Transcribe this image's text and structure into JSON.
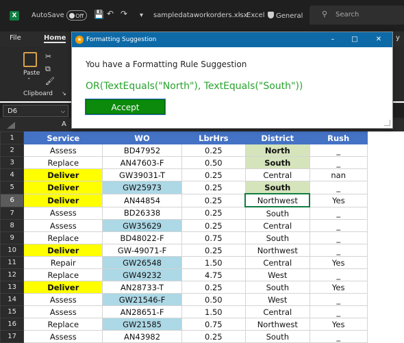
{
  "titlebar": {
    "autosave_label": "AutoSave",
    "autosave_state": "Off",
    "filename": "sampledataworkorders.xlsx",
    "app": "Excel",
    "sensitivity": "General",
    "search_placeholder": "Search"
  },
  "ribbon_tabs": {
    "file": "File",
    "home": "Home",
    "more": "y"
  },
  "ribbon": {
    "paste": "Paste",
    "clipboard": "Clipboard"
  },
  "namebox": "D6",
  "column_hint": "A",
  "dialog": {
    "title": "Formatting Suggestion",
    "message": "You have a Formatting Rule Suggestion",
    "formula": "OR(TextEquals(\"North\"), TextEquals(\"South\"))",
    "accept": "Accept"
  },
  "table": {
    "headers": [
      "Service",
      "WO",
      "LbrHrs",
      "District",
      "Rush"
    ],
    "rows": [
      {
        "n": "2",
        "cells": [
          "Assess",
          "BD47952",
          "0.25",
          "North",
          "_"
        ],
        "styles": [
          "",
          "",
          "",
          "grn",
          ""
        ]
      },
      {
        "n": "3",
        "cells": [
          "Replace",
          "AN47603-F",
          "0.50",
          "South",
          "_"
        ],
        "styles": [
          "",
          "",
          "",
          "grn",
          ""
        ]
      },
      {
        "n": "4",
        "cells": [
          "Deliver",
          "GW39031-T",
          "0.25",
          "Central",
          "nan"
        ],
        "styles": [
          "yel",
          "",
          "",
          "",
          ""
        ]
      },
      {
        "n": "5",
        "cells": [
          "Deliver",
          "GW25973",
          "0.25",
          "South",
          "_"
        ],
        "styles": [
          "yel",
          "blu",
          "",
          "grn",
          ""
        ]
      },
      {
        "n": "6",
        "cells": [
          "Deliver",
          "AN44854",
          "0.25",
          "Northwest",
          "Yes"
        ],
        "styles": [
          "yel",
          "",
          "",
          "act",
          ""
        ]
      },
      {
        "n": "7",
        "cells": [
          "Assess",
          "BD26338",
          "0.25",
          "South",
          "_"
        ],
        "styles": [
          "",
          "",
          "",
          "",
          ""
        ]
      },
      {
        "n": "8",
        "cells": [
          "Assess",
          "GW35629",
          "0.25",
          "Central",
          "_"
        ],
        "styles": [
          "",
          "blu",
          "",
          "",
          ""
        ]
      },
      {
        "n": "9",
        "cells": [
          "Replace",
          "BD48022-F",
          "0.75",
          "South",
          "_"
        ],
        "styles": [
          "",
          "",
          "",
          "",
          ""
        ]
      },
      {
        "n": "10",
        "cells": [
          "Deliver",
          "GW-49071-F",
          "0.25",
          "Northwest",
          "_"
        ],
        "styles": [
          "yel",
          "",
          "",
          "",
          ""
        ]
      },
      {
        "n": "11",
        "cells": [
          "Repair",
          "GW26548",
          "1.50",
          "Central",
          "Yes"
        ],
        "styles": [
          "",
          "blu",
          "",
          "",
          ""
        ]
      },
      {
        "n": "12",
        "cells": [
          "Replace",
          "GW49232",
          "4.75",
          "West",
          "_"
        ],
        "styles": [
          "",
          "blu",
          "",
          "",
          ""
        ]
      },
      {
        "n": "13",
        "cells": [
          "Deliver",
          "AN28733-T",
          "0.25",
          "South",
          "Yes"
        ],
        "styles": [
          "yel",
          "",
          "",
          "",
          ""
        ]
      },
      {
        "n": "14",
        "cells": [
          "Assess",
          "GW21546-F",
          "0.50",
          "West",
          "_"
        ],
        "styles": [
          "",
          "blu",
          "",
          "",
          ""
        ]
      },
      {
        "n": "15",
        "cells": [
          "Assess",
          "AN28651-F",
          "1.50",
          "Central",
          "_"
        ],
        "styles": [
          "",
          "",
          "",
          "",
          ""
        ]
      },
      {
        "n": "16",
        "cells": [
          "Replace",
          "GW21585",
          "0.75",
          "Northwest",
          "Yes"
        ],
        "styles": [
          "",
          "blu",
          "",
          "",
          ""
        ]
      },
      {
        "n": "17",
        "cells": [
          "Assess",
          "AN43982",
          "0.25",
          "South",
          "_"
        ],
        "styles": [
          "",
          "",
          "",
          "",
          ""
        ]
      }
    ]
  },
  "colors": {
    "highlight_yellow": "#ffff00",
    "highlight_blue": "#add8e6",
    "highlight_green": "#d6e4bc",
    "header_blue": "#4472c4",
    "dialog_title": "#0e6aa7",
    "accept_green": "#0b8a0b",
    "formula_green": "#27a32c"
  }
}
